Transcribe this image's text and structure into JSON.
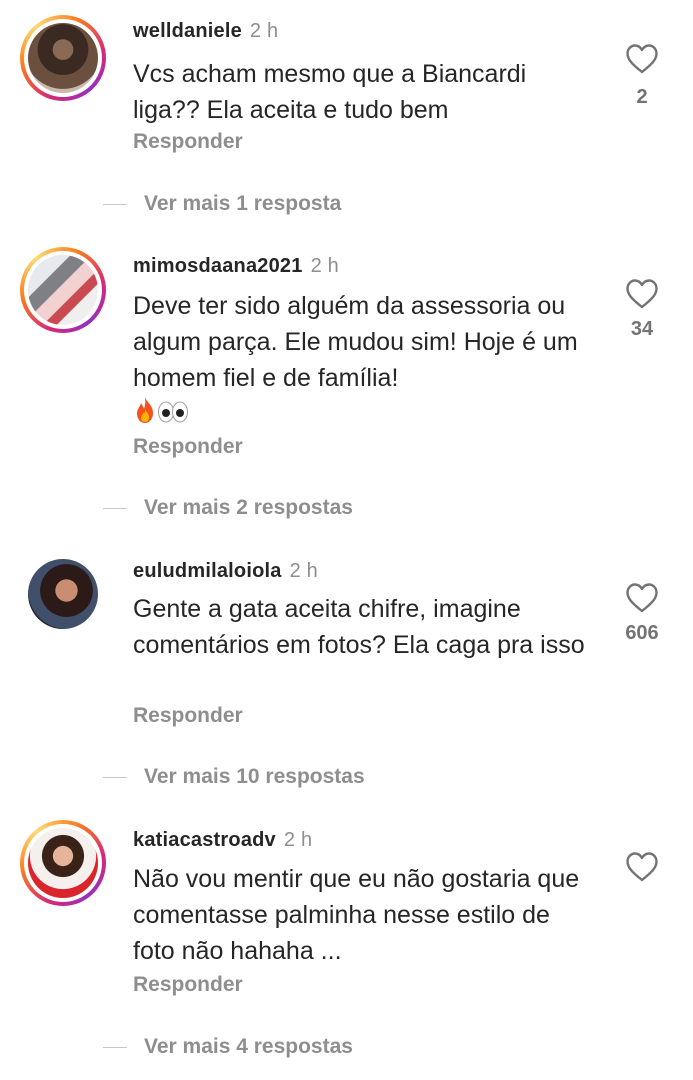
{
  "comments": [
    {
      "username": "welldaniele",
      "time": "2 h",
      "text": "Vcs acham mesmo que a Biancardi liga?? Ela aceita e tudo bem",
      "likes": "2",
      "reply_label": "Responder",
      "more_replies": "Ver mais 1 resposta",
      "avatar_ring": true
    },
    {
      "username": "mimosdaana2021",
      "time": "2 h",
      "text": "Deve ter sido alguém da assessoria ou algum parça. Ele mudou sim! Hoje é um homem fiel e de família!",
      "emoji": "fire-eyes",
      "likes": "34",
      "reply_label": "Responder",
      "more_replies": "Ver mais 2 respostas",
      "avatar_ring": true
    },
    {
      "username": "euludmilaloiola",
      "time": "2 h",
      "text": "Gente a gata aceita chifre, imagine comentários em fotos? Ela caga pra isso",
      "likes": "606",
      "reply_label": "Responder",
      "more_replies": "Ver mais 10 respostas",
      "avatar_ring": false
    },
    {
      "username": "katiacastroadv",
      "time": "2 h",
      "text": "Não vou mentir que eu não gostaria que comentasse palminha nesse estilo de foto não hahaha ...",
      "likes": "",
      "reply_label": "Responder",
      "more_replies": "Ver mais 4 respostas",
      "avatar_ring": true
    }
  ],
  "icons": {
    "like": "heart-outline-icon",
    "emoji_fire": "fire-emoji",
    "emoji_eyes": "eyes-emoji"
  },
  "colors": {
    "text": "#262626",
    "muted": "#8e8e8e",
    "story_ring_start": "#d62976",
    "story_ring_end": "#feda75"
  }
}
